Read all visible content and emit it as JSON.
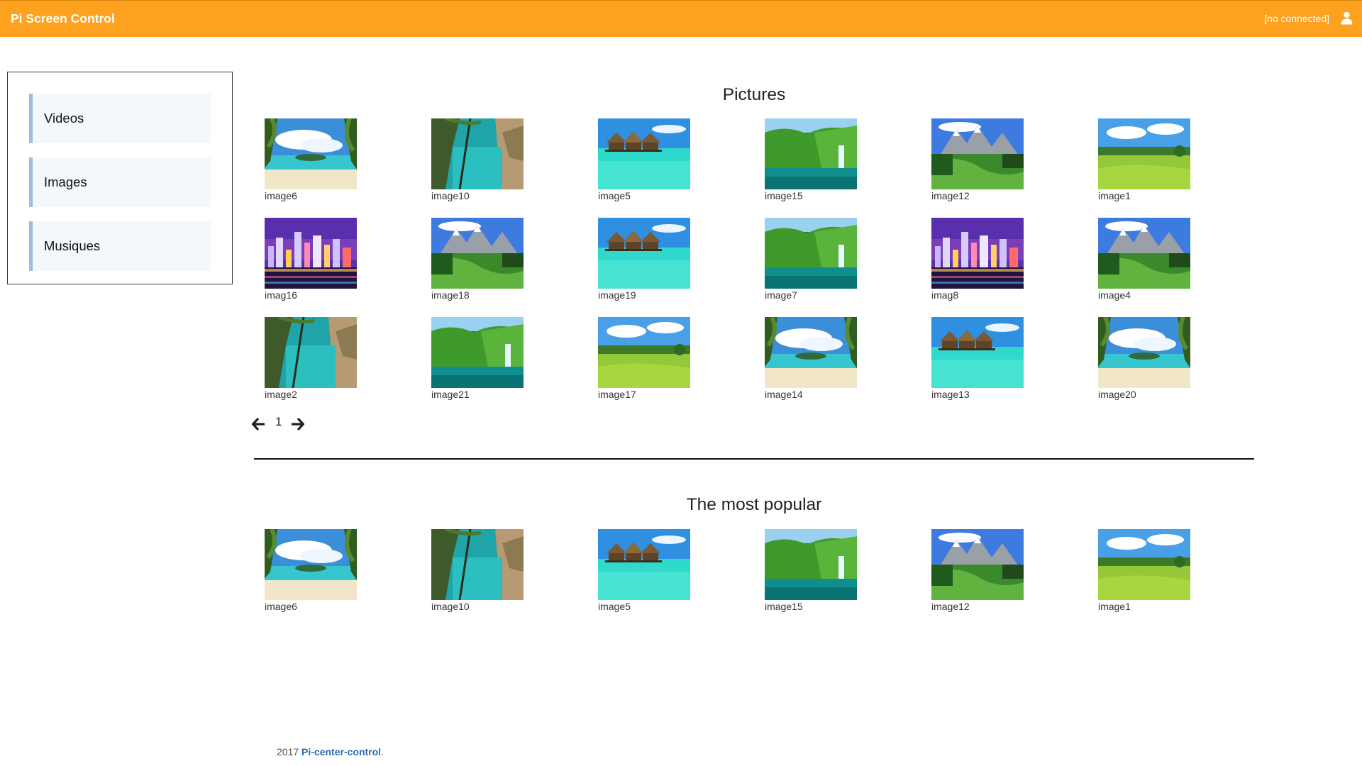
{
  "navbar": {
    "brand": "Pi Screen Control",
    "status": "[no connected]",
    "user_icon": "user-icon"
  },
  "sidebar": {
    "items": [
      {
        "label": "Videos"
      },
      {
        "label": "Images"
      },
      {
        "label": "Musiques"
      }
    ]
  },
  "pictures": {
    "title": "Pictures",
    "items": [
      {
        "caption": "image6",
        "scene": "beach"
      },
      {
        "caption": "image10",
        "scene": "cove"
      },
      {
        "caption": "image5",
        "scene": "bungalow"
      },
      {
        "caption": "image15",
        "scene": "waterfall"
      },
      {
        "caption": "image12",
        "scene": "mountain"
      },
      {
        "caption": "image1",
        "scene": "golf"
      },
      {
        "caption": "imag16",
        "scene": "city"
      },
      {
        "caption": "image18",
        "scene": "mountain"
      },
      {
        "caption": "image19",
        "scene": "bungalow"
      },
      {
        "caption": "image7",
        "scene": "waterfall"
      },
      {
        "caption": "imag8",
        "scene": "city"
      },
      {
        "caption": "image4",
        "scene": "mountain"
      },
      {
        "caption": "image2",
        "scene": "cove"
      },
      {
        "caption": "image21",
        "scene": "waterfall"
      },
      {
        "caption": "image17",
        "scene": "golf"
      },
      {
        "caption": "image14",
        "scene": "beach"
      },
      {
        "caption": "image13",
        "scene": "bungalow"
      },
      {
        "caption": "image20",
        "scene": "beach"
      }
    ]
  },
  "pagination": {
    "prev_icon": "arrow-left-icon",
    "page": "1",
    "next_icon": "arrow-right-icon"
  },
  "popular": {
    "title": "The most popular",
    "items": [
      {
        "caption": "image6",
        "scene": "beach"
      },
      {
        "caption": "image10",
        "scene": "cove"
      },
      {
        "caption": "image5",
        "scene": "bungalow"
      },
      {
        "caption": "image15",
        "scene": "waterfall"
      },
      {
        "caption": "image12",
        "scene": "mountain"
      },
      {
        "caption": "image1",
        "scene": "golf"
      }
    ]
  },
  "footer": {
    "year": "2017",
    "link": "Pi-center-control",
    "period": "."
  }
}
